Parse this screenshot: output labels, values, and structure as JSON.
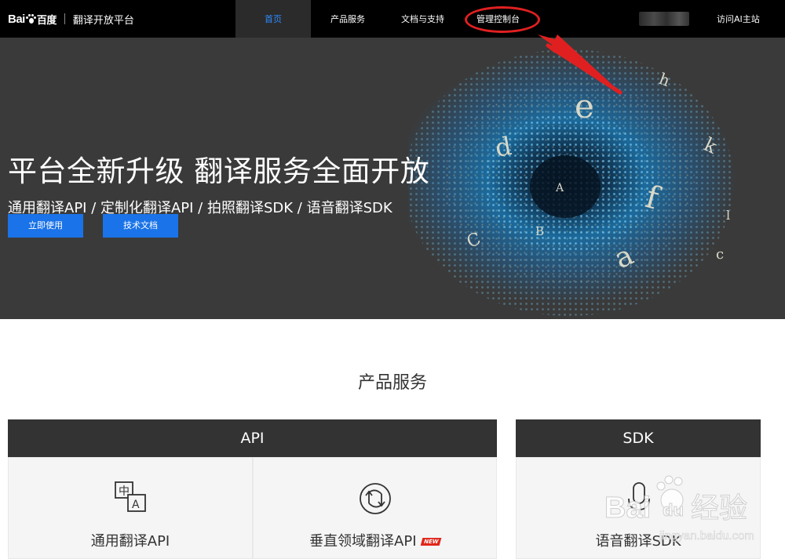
{
  "nav": {
    "brand": "Bai",
    "brand_cn": "百度",
    "platform": "翻译开放平台",
    "items": [
      "首页",
      "产品服务",
      "文档与支持",
      "管理控制台"
    ],
    "active_index": 0,
    "visit_link": "访问AI主站"
  },
  "hero": {
    "title": "平台全新升级 翻译服务全面开放",
    "subtitle": "通用翻译API / 定制化翻译API / 拍照翻译SDK / 语音翻译SDK",
    "buttons": [
      "立即使用",
      "技术文档"
    ],
    "letters": [
      "h",
      "e",
      "d",
      "k",
      "A",
      "f",
      "B",
      "C",
      "a",
      "c",
      "l"
    ]
  },
  "products": {
    "title": "产品服务",
    "api_header": "API",
    "sdk_header": "SDK",
    "cards": [
      {
        "label": "通用翻译API",
        "icon": "translate-icon",
        "icon_glyph_zh": "中",
        "icon_glyph_en": "A"
      },
      {
        "label": "垂直领域翻译API",
        "icon": "sync-icon",
        "badge": "NEW"
      },
      {
        "label": "语音翻译SDK",
        "icon": "microphone-icon"
      }
    ]
  },
  "watermark": {
    "text_cn": "经验",
    "text_brand": "Bai",
    "text_du": "du",
    "url": "jingyan.baidu.com"
  },
  "colors": {
    "topbar": "#000000",
    "hero_bg": "#3a3a3a",
    "accent": "#1a73e8",
    "active_nav": "#2f8cff",
    "annotation": "#e02020"
  }
}
